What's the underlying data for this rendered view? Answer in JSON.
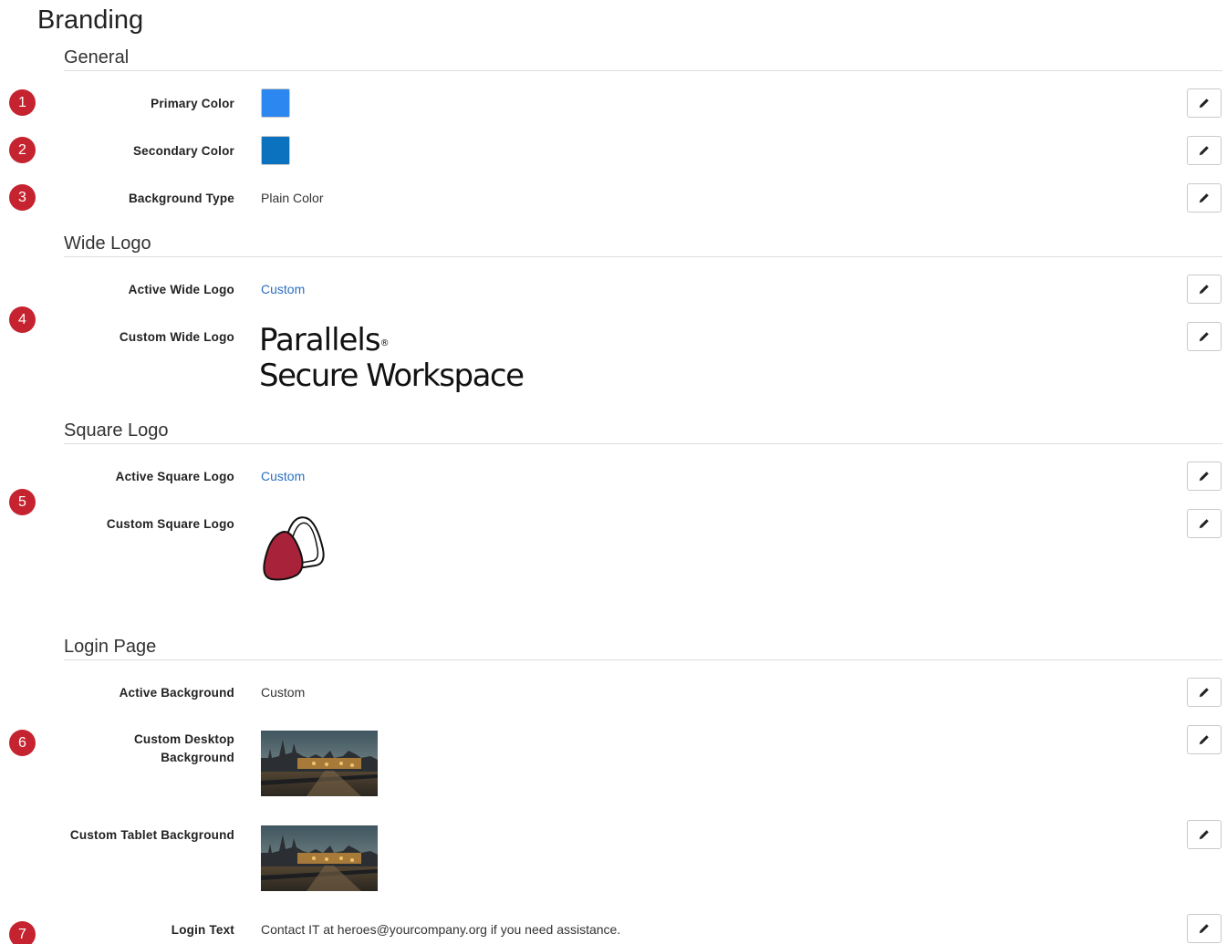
{
  "page": {
    "title": "Branding"
  },
  "badges": [
    "1",
    "2",
    "3",
    "4",
    "5",
    "6",
    "7"
  ],
  "general": {
    "title": "General",
    "primary_color": {
      "label": "Primary Color",
      "color": "#2d87f0"
    },
    "secondary_color": {
      "label": "Secondary Color",
      "color": "#0a72bf"
    },
    "background_type": {
      "label": "Background Type",
      "value": "Plain Color"
    }
  },
  "wide_logo": {
    "title": "Wide Logo",
    "active": {
      "label": "Active Wide Logo",
      "value": "Custom"
    },
    "custom": {
      "label": "Custom Wide Logo",
      "line1": "Parallels",
      "mark": "®",
      "line2": "Secure Workspace"
    }
  },
  "square_logo": {
    "title": "Square Logo",
    "active": {
      "label": "Active Square Logo",
      "value": "Custom"
    },
    "custom": {
      "label": "Custom Square Logo"
    }
  },
  "login_page": {
    "title": "Login Page",
    "active_background": {
      "label": "Active Background",
      "value": "Custom"
    },
    "desktop_background": {
      "label_line1": "Custom Desktop",
      "label_line2": "Background"
    },
    "tablet_background": {
      "label": "Custom Tablet Background"
    },
    "login_text": {
      "label": "Login Text",
      "value": "Contact IT at heroes@yourcompany.org if you need assistance."
    }
  },
  "colors": {
    "badge": "#c5232f",
    "link": "#2a6fc0",
    "logo_red": "#a8233a"
  },
  "icons": {
    "edit": "pencil-icon"
  }
}
